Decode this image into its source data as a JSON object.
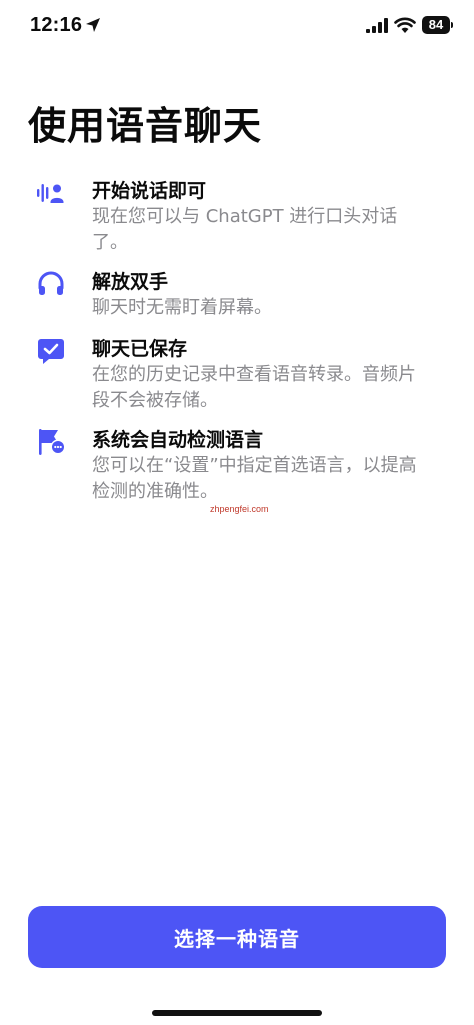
{
  "status_bar": {
    "time": "12:16",
    "battery": "84"
  },
  "page": {
    "title": "使用语音聊天"
  },
  "features": [
    {
      "icon": "voice-wave-person-icon",
      "title": "开始说话即可",
      "description": "现在您可以与 ChatGPT 进行口头对话了。"
    },
    {
      "icon": "headphones-icon",
      "title": "解放双手",
      "description": "聊天时无需盯着屏幕。"
    },
    {
      "icon": "chat-check-icon",
      "title": "聊天已保存",
      "description": "在您的历史记录中查看语音转录。音频片段不会被存储。"
    },
    {
      "icon": "flag-chat-icon",
      "title": "系统会自动检测语言",
      "description": "您可以在“设置”中指定首选语言，以提高检测的准确性。"
    }
  ],
  "watermark": "zhpengfei.com",
  "actions": {
    "choose_language": "选择一种语音"
  },
  "colors": {
    "accent": "#4d55f5",
    "text_primary": "#0b0b0b",
    "text_secondary": "#8a8a8e"
  }
}
